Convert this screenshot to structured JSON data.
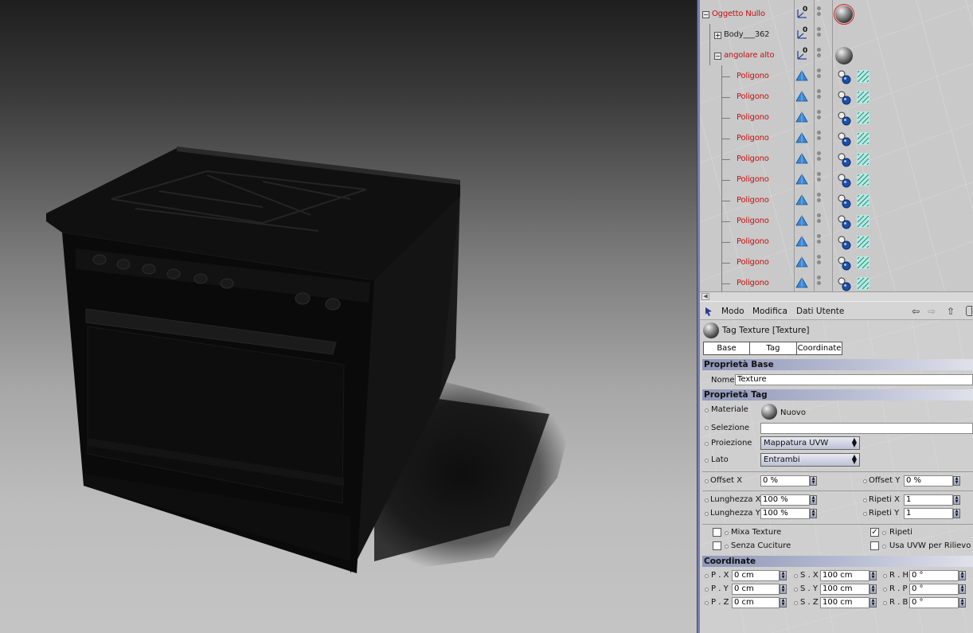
{
  "object_manager": {
    "rows": [
      {
        "name": "Oggetto Nullo",
        "level": 0,
        "expander": "−",
        "color": "red",
        "icon": "null-axis-icon",
        "axis_value": "0",
        "material": "material-ball-selected"
      },
      {
        "name": "Body___362",
        "level": 1,
        "expander": "+",
        "color": "dark",
        "icon": "null-axis-icon",
        "axis_value": "0"
      },
      {
        "name": "angolare alto",
        "level": 1,
        "expander": "−",
        "color": "red",
        "icon": "null-axis-icon",
        "axis_value": "0",
        "material": "material-ball"
      },
      {
        "name": "Poligono",
        "level": 2,
        "color": "red",
        "icon": "polygon-icon",
        "tags": [
          "texture-tag-icon",
          "uvw-tag-icon"
        ]
      },
      {
        "name": "Poligono",
        "level": 2,
        "color": "red",
        "icon": "polygon-icon",
        "tags": [
          "texture-tag-icon",
          "uvw-tag-icon"
        ]
      },
      {
        "name": "Poligono",
        "level": 2,
        "color": "red",
        "icon": "polygon-icon",
        "tags": [
          "texture-tag-icon",
          "uvw-tag-icon"
        ]
      },
      {
        "name": "Poligono",
        "level": 2,
        "color": "red",
        "icon": "polygon-icon",
        "tags": [
          "texture-tag-icon",
          "uvw-tag-icon"
        ]
      },
      {
        "name": "Poligono",
        "level": 2,
        "color": "red",
        "icon": "polygon-icon",
        "tags": [
          "texture-tag-icon",
          "uvw-tag-icon"
        ]
      },
      {
        "name": "Poligono",
        "level": 2,
        "color": "red",
        "icon": "polygon-icon",
        "tags": [
          "texture-tag-icon",
          "uvw-tag-icon"
        ]
      },
      {
        "name": "Poligono",
        "level": 2,
        "color": "red",
        "icon": "polygon-icon",
        "tags": [
          "texture-tag-icon",
          "uvw-tag-icon"
        ]
      },
      {
        "name": "Poligono",
        "level": 2,
        "color": "red",
        "icon": "polygon-icon",
        "tags": [
          "texture-tag-icon",
          "uvw-tag-icon"
        ]
      },
      {
        "name": "Poligono",
        "level": 2,
        "color": "red",
        "icon": "polygon-icon",
        "tags": [
          "texture-tag-icon",
          "uvw-tag-icon"
        ]
      },
      {
        "name": "Poligono",
        "level": 2,
        "color": "red",
        "icon": "polygon-icon",
        "tags": [
          "texture-tag-icon",
          "uvw-tag-icon"
        ]
      },
      {
        "name": "Poligono",
        "level": 2,
        "color": "red",
        "icon": "polygon-icon",
        "tags": [
          "texture-tag-icon",
          "uvw-tag-icon"
        ]
      }
    ],
    "colors": {
      "red": "#c41010",
      "dark": "#222222"
    }
  },
  "attribute_manager": {
    "menu": {
      "modo": "Modo",
      "modifica": "Modifica",
      "dati_utente": "Dati Utente"
    },
    "title": "Tag Texture [Texture]",
    "tabs": {
      "base": "Base",
      "tag": "Tag",
      "coordinate": "Coordinate"
    },
    "sections": {
      "base": "Proprietà Base",
      "tag": "Proprietà Tag",
      "coordinate": "Coordinate"
    },
    "nome": {
      "label": "Nome",
      "value": "Texture"
    },
    "materiale": {
      "label": "Materiale",
      "value": "Nuovo"
    },
    "selezione": {
      "label": "Selezione",
      "value": ""
    },
    "proiezione": {
      "label": "Proiezione",
      "value": "Mappatura UVW"
    },
    "lato": {
      "label": "Lato",
      "value": "Entrambi"
    },
    "offset_x": {
      "label": "Offset X",
      "value": "0 %"
    },
    "offset_y": {
      "label": "Offset Y",
      "value": "0 %"
    },
    "lunghezza_x": {
      "label": "Lunghezza X",
      "value": "100 %"
    },
    "lunghezza_y": {
      "label": "Lunghezza Y",
      "value": "100 %"
    },
    "ripeti_x": {
      "label": "Ripeti X",
      "value": "1"
    },
    "ripeti_y": {
      "label": "Ripeti Y",
      "value": "1"
    },
    "checks": {
      "mixa_texture": {
        "label": "Mixa Texture",
        "checked": false
      },
      "senza_cuciture": {
        "label": "Senza Cuciture",
        "checked": false
      },
      "ripeti": {
        "label": "Ripeti",
        "checked": true
      },
      "usa_uvw": {
        "label": "Usa UVW per Rilievo",
        "checked": false
      }
    },
    "coords": {
      "px": {
        "label": "P . X",
        "value": "0 cm"
      },
      "py": {
        "label": "P . Y",
        "value": "0 cm"
      },
      "pz": {
        "label": "P . Z",
        "value": "0 cm"
      },
      "sx": {
        "label": "S . X",
        "value": "100 cm"
      },
      "sy": {
        "label": "S . Y",
        "value": "100 cm"
      },
      "sz": {
        "label": "S . Z",
        "value": "100 cm"
      },
      "rh": {
        "label": "R . H",
        "value": "0 °"
      },
      "rp": {
        "label": "R . P",
        "value": "0 °"
      },
      "rb": {
        "label": "R . B",
        "value": "0 °"
      }
    },
    "check_mark": "✓"
  },
  "colors": {
    "section_header": "#9097b8",
    "panel_bg": "#cfcfcf",
    "selection_red": "#e02020",
    "poly_blue": "#3a8ad8"
  }
}
